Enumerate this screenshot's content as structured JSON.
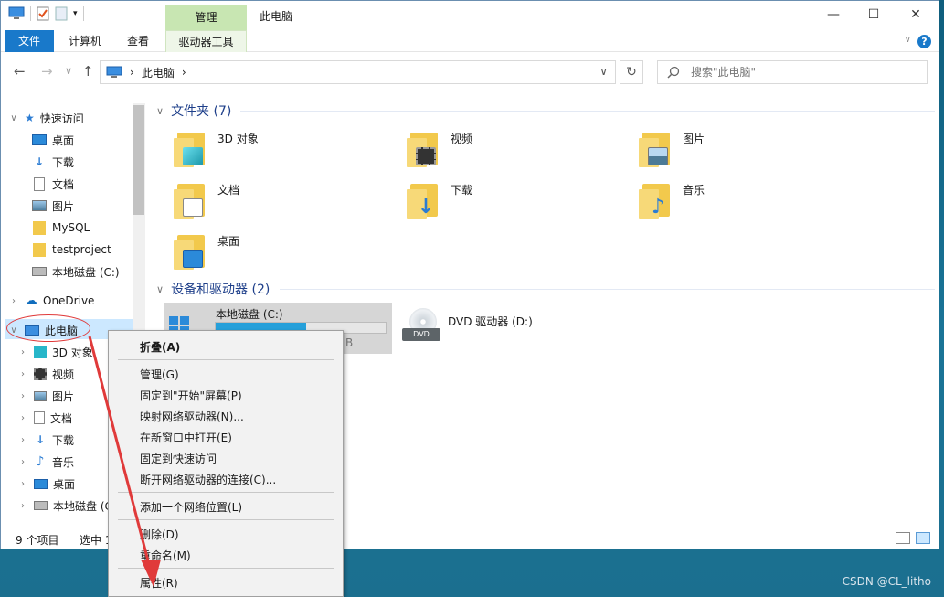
{
  "window": {
    "title": "此电脑",
    "context_tab_group": "管理",
    "controls": {
      "minimize": "—",
      "maximize": "☐",
      "close": "✕"
    }
  },
  "ribbon": {
    "tabs": [
      "文件",
      "计算机",
      "查看",
      "驱动器工具"
    ],
    "help": "?"
  },
  "address": {
    "path": "此电脑",
    "separator": "›",
    "search_placeholder": "搜索\"此电脑\""
  },
  "nav": {
    "quick_access": "快速访问",
    "quick_items": [
      "桌面",
      "下载",
      "文档",
      "图片",
      "MySQL",
      "testproject",
      "本地磁盘 (C:)"
    ],
    "onedrive": "OneDrive",
    "this_pc": "此电脑",
    "pc_items": [
      "3D 对象",
      "视频",
      "图片",
      "文档",
      "下载",
      "音乐",
      "桌面",
      "本地磁盘 (C"
    ]
  },
  "content": {
    "folders_header": "文件夹 (7)",
    "folders": [
      "3D 对象",
      "视频",
      "图片",
      "文档",
      "下载",
      "音乐",
      "桌面"
    ],
    "devices_header": "设备和驱动器 (2)",
    "drive_c": {
      "label": "本地磁盘 (C:)",
      "fill_fraction": 0.53,
      "trailing_text": "B"
    },
    "dvd": {
      "label": "DVD 驱动器 (D:)",
      "badge": "DVD"
    }
  },
  "status": {
    "count": "9 个项目",
    "selected": "选中 1"
  },
  "context_menu": {
    "items": [
      "折叠(A)",
      "管理(G)",
      "固定到\"开始\"屏幕(P)",
      "映射网络驱动器(N)...",
      "在新窗口中打开(E)",
      "固定到快速访问",
      "断开网络驱动器的连接(C)...",
      "添加一个网络位置(L)",
      "删除(D)",
      "重命名(M)",
      "属性(R)"
    ]
  },
  "watermark": "CSDN @CL_litho",
  "colors": {
    "accent": "#1979ca",
    "annotation": "#e03a3a",
    "selection": "#cce8ff",
    "ribbon_context": "#c8e6b2"
  }
}
